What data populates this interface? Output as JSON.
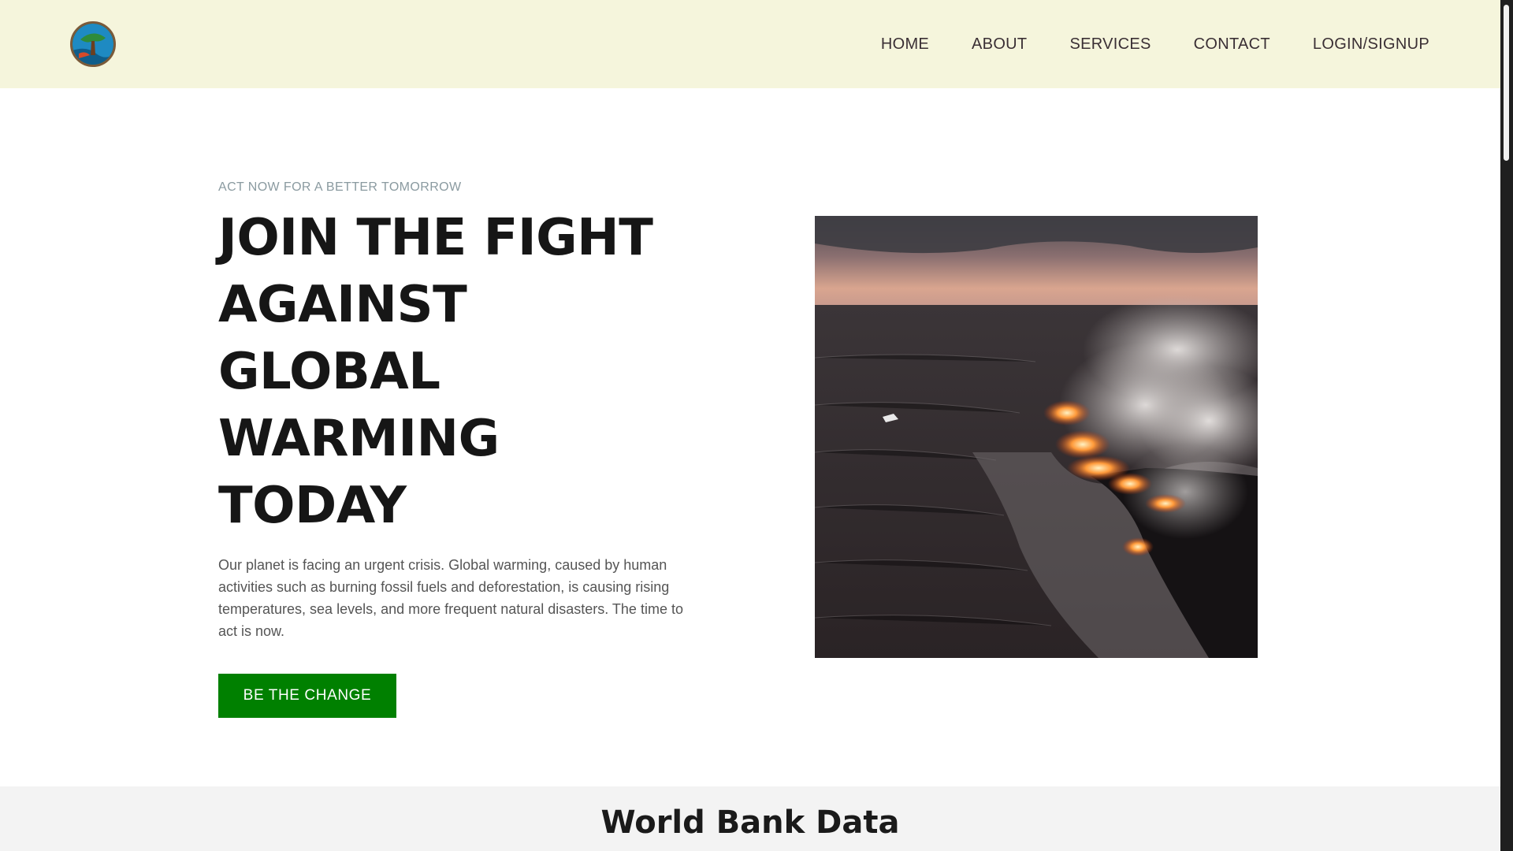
{
  "header": {
    "logo_icon": "earth-tree-logo-icon",
    "nav": [
      {
        "label": "HOME"
      },
      {
        "label": "ABOUT"
      },
      {
        "label": "SERVICES"
      },
      {
        "label": "CONTACT"
      },
      {
        "label": "LOGIN/SIGNUP"
      }
    ]
  },
  "hero": {
    "eyebrow": "ACT NOW FOR A BETTER TOMORROW",
    "headline_lines": [
      "JOIN THE FIGHT",
      "AGAINST",
      "GLOBAL",
      "WARMING",
      "TODAY"
    ],
    "body": "Our planet is facing an urgent crisis. Global warming, caused by human activities such as burning fossil fuels and deforestation, is causing rising temperatures, sea levels, and more frequent natural disasters. The time to act is now.",
    "cta_label": "BE THE CHANGE",
    "cta_color": "#008000"
  },
  "data_section": {
    "title": "World Bank Data"
  },
  "colors": {
    "header_bg": "#f5f5dc",
    "accent": "#008000",
    "text_dark": "#161616"
  }
}
